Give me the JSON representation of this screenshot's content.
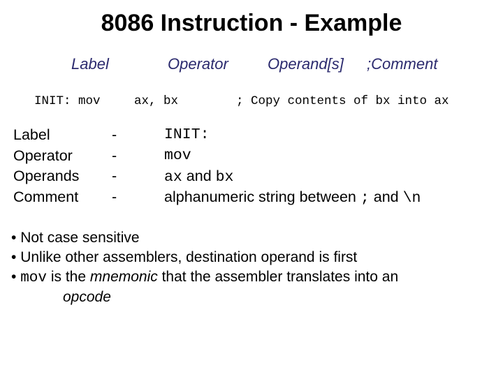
{
  "title": "8086 Instruction - Example",
  "headers": {
    "label": "Label",
    "operator": "Operator",
    "operands": "Operand[s]",
    "comment": ";Comment"
  },
  "code_line": {
    "label": "INIT: mov",
    "operands": "ax, bx",
    "comment": "; Copy contents of bx into ax"
  },
  "definitions": [
    {
      "term": "Label",
      "sep": "-",
      "value": "INIT:"
    },
    {
      "term": "Operator",
      "sep": "-",
      "value": "mov"
    },
    {
      "term": "Operands",
      "sep": "-",
      "value_code1": "ax",
      "value_text": " and ",
      "value_code2": "bx"
    },
    {
      "term": "Comment",
      "sep": "-",
      "value_text": "alphanumeric string between ",
      "value_code1": ";",
      "value_text2": " and ",
      "value_code2": "\\n"
    }
  ],
  "bullets": [
    {
      "text": "Not case sensitive"
    },
    {
      "text": "Unlike other assemblers, destination operand is first"
    },
    {
      "code": "mov",
      "text1": " is the ",
      "em": "mnemonic",
      "text2": " that the assembler translates into an",
      "em2": "opcode"
    }
  ],
  "bullet_char": "•",
  "colors": {
    "header_text": "#2b2a6e",
    "body_text": "#000000",
    "background": "#ffffff"
  }
}
